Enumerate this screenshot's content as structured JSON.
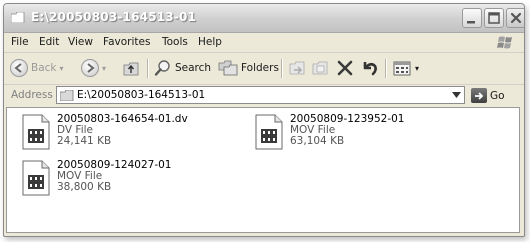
{
  "window": {
    "title": "E:\\20050803-164513-01"
  },
  "menu": {
    "items": [
      "File",
      "Edit",
      "View",
      "Favorites",
      "Tools",
      "Help"
    ]
  },
  "toolbar": {
    "back_label": "Back",
    "search_label": "Search",
    "folders_label": "Folders"
  },
  "address": {
    "label": "Address",
    "path": "E:\\20050803-164513-01",
    "go_label": "Go"
  },
  "files": [
    {
      "name": "20050803-164654-01.dv",
      "type": "DV File",
      "size": "24,141 KB"
    },
    {
      "name": "20050809-123952-01",
      "type": "MOV File",
      "size": "63,104 KB"
    },
    {
      "name": "20050809-124027-01",
      "type": "MOV File",
      "size": "38,800 KB"
    }
  ]
}
